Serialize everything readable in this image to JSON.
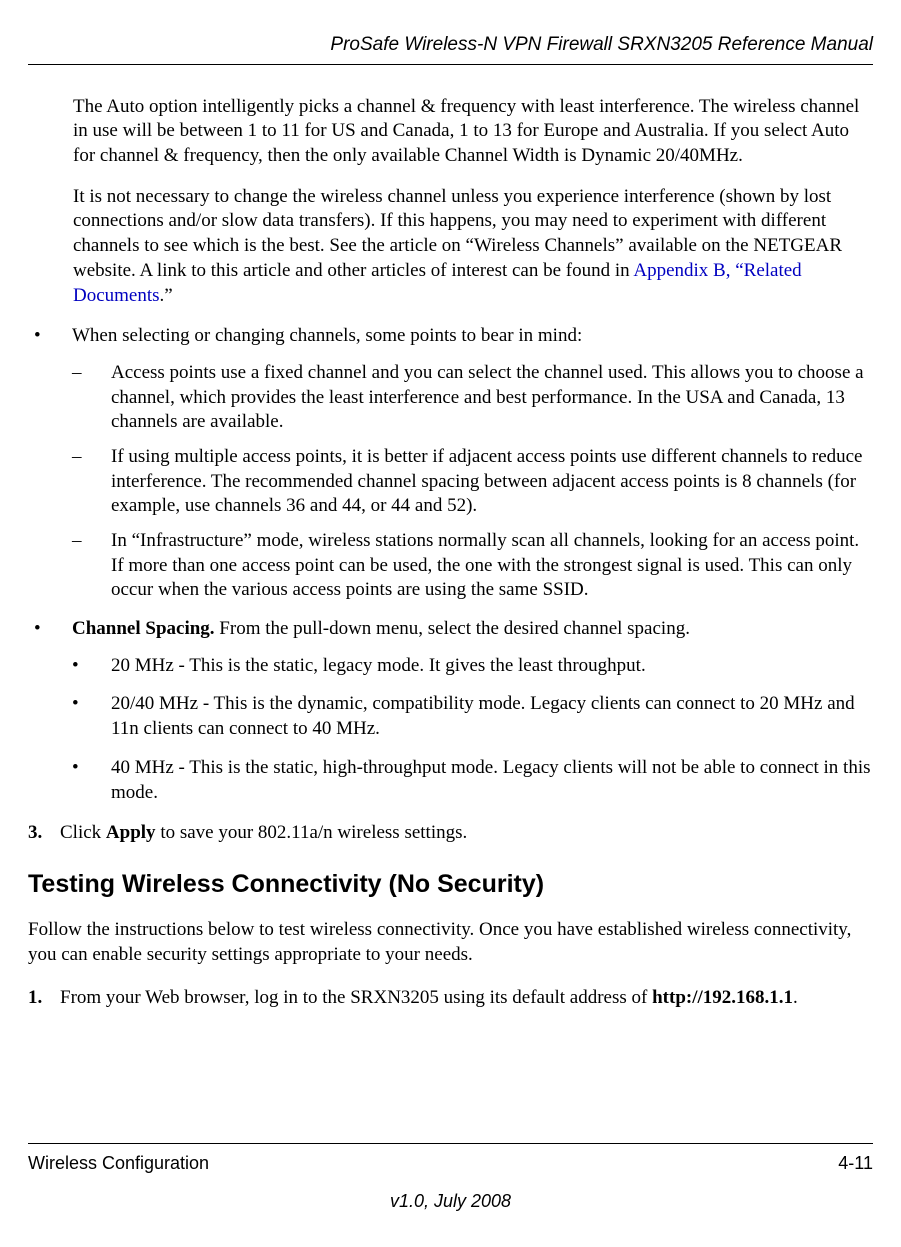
{
  "header": {
    "title": "ProSafe Wireless-N VPN Firewall SRXN3205 Reference Manual"
  },
  "para1": "The Auto option intelligently picks a channel & frequency with least interference. The wireless channel in use will be between 1 to 11 for US and Canada, 1 to 13 for Europe and Australia. If you select Auto for channel & frequency, then the only available Channel Width is Dynamic 20/40MHz.",
  "para2_before_link": "It is not necessary to change the wireless channel unless you experience interference (shown by lost connections and/or slow data transfers). If this happens, you may need to experiment with different channels to see which is the best. See the article on “Wireless Channels” available on the NETGEAR website. A link to this article and other articles of interest can be found in ",
  "para2_link": "Appendix B, “Related Documents",
  "para2_after_link": ".”",
  "bulletA": {
    "marker": "•",
    "text": "When selecting or changing channels, some points to bear in mind:",
    "sub": [
      {
        "marker": "–",
        "text": "Access points use a fixed channel and you can select the channel used. This allows you to choose a channel, which provides the least interference and best performance. In the USA and Canada, 13 channels are available."
      },
      {
        "marker": "–",
        "text": "If using multiple access points, it is better if adjacent access points use different channels to reduce interference. The recommended channel spacing between adjacent access points is 8 channels (for example, use channels 36 and 44, or 44 and 52)."
      },
      {
        "marker": "–",
        "text": "In “Infrastructure” mode, wireless stations normally scan all channels, looking for an access point. If more than one access point can be used, the one with the strongest signal is used. This can only occur when the various access points are using the same SSID."
      }
    ]
  },
  "bulletB": {
    "marker": "•",
    "lead_bold": "Channel Spacing.",
    "lead_rest": " From the pull-down menu, select the desired channel spacing.",
    "sub": [
      {
        "marker": "•",
        "text": "20 MHz - This is the static, legacy mode. It gives the least throughput."
      },
      {
        "marker": "•",
        "text": "20/40 MHz - This is the dynamic, compatibility mode. Legacy clients can connect to 20 MHz and 11n clients can connect to 40 MHz."
      },
      {
        "marker": "•",
        "text": "40 MHz - This is the static, high-throughput mode. Legacy clients will not be able to connect in this mode."
      }
    ]
  },
  "step3": {
    "marker": "3.",
    "before_bold": "Click ",
    "bold": "Apply",
    "after_bold": " to save your 802.11a/n wireless settings."
  },
  "h2": "Testing Wireless Connectivity (No Security)",
  "intro": "Follow the instructions below to test wireless connectivity. Once you have established wireless connectivity, you can enable security settings appropriate to your needs.",
  "step1b": {
    "marker": "1.",
    "before_bold": "From your Web browser, log in to the SRXN3205 using its default address of ",
    "bold": "http://192.168.1.1",
    "after_bold": "."
  },
  "footer": {
    "left": "Wireless Configuration",
    "right": "4-11",
    "version": "v1.0, July 2008"
  }
}
